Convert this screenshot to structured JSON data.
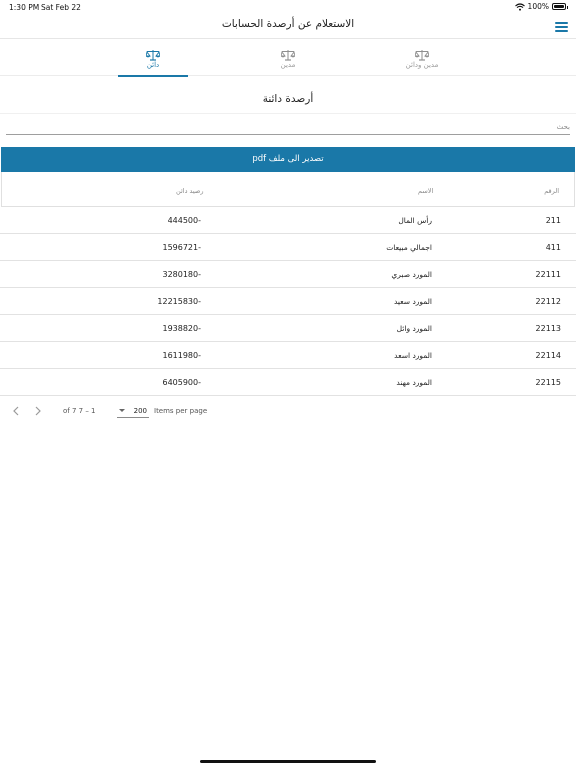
{
  "status_bar": {
    "time": "1:30 PM",
    "date": "Sat Feb 22",
    "battery": "100%",
    "wifi_icon": "wifi-icon",
    "battery_icon": "battery-icon"
  },
  "header": {
    "title": "الاستعلام عن أرصدة الحسابات",
    "menu_icon": "hamburger-menu-icon"
  },
  "tabs": [
    {
      "label": "مدين ودائن",
      "icon": "scale-icon",
      "active": false
    },
    {
      "label": "مدين",
      "icon": "scale-icon",
      "active": false
    },
    {
      "label": "دائن",
      "icon": "scale-icon",
      "active": true
    }
  ],
  "section_title": "أرصدة دائنة",
  "search": {
    "placeholder": "بحث",
    "value": ""
  },
  "export_button": "تصدير الى ملف pdf",
  "table": {
    "columns": [
      "الرقم",
      "الاسم",
      "رصيد دائن"
    ],
    "rows": [
      {
        "number": "211",
        "name": "رأس المال",
        "balance": "444500-"
      },
      {
        "number": "411",
        "name": "اجمالي مبيعات",
        "balance": "1596721-"
      },
      {
        "number": "22111",
        "name": "المورد صبري",
        "balance": "3280180-"
      },
      {
        "number": "22112",
        "name": "المورد سعيد",
        "balance": "12215830-"
      },
      {
        "number": "22113",
        "name": "المورد وائل",
        "balance": "1938820-"
      },
      {
        "number": "22114",
        "name": "المورد اسعد",
        "balance": "1611980-"
      },
      {
        "number": "22115",
        "name": "المورد مهند",
        "balance": "6405900-"
      }
    ]
  },
  "paginator": {
    "range": "of 7 7 – 1",
    "page_size": "200",
    "items_per_page_label": "Items per page"
  },
  "colors": {
    "accent": "#1a78a8",
    "divider": "#e2e2e2"
  }
}
